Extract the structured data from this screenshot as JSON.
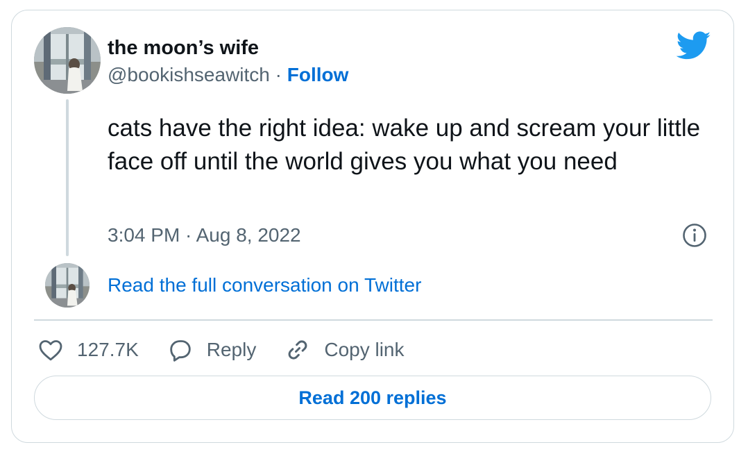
{
  "tweet": {
    "display_name": "the moon’s wife",
    "handle": "@bookishseawitch",
    "separator": " · ",
    "follow_label": "Follow",
    "text": "cats have the right idea: wake up and scream your little face off until the world gives you what you need",
    "timestamp": "3:04 PM · Aug 8, 2022",
    "read_conversation_label": "Read the full conversation on Twitter"
  },
  "actions": {
    "likes_count": "127.7K",
    "reply_label": "Reply",
    "copy_link_label": "Copy link"
  },
  "replies_button_label": "Read 200 replies",
  "icons": {
    "brand": "twitter-bird-icon",
    "info": "info-icon",
    "like": "heart-icon",
    "reply": "speech-bubble-icon",
    "copy": "link-icon"
  },
  "colors": {
    "brand_blue": "#1d9bf0",
    "link_blue": "#006fd6",
    "text": "#0f1419",
    "muted": "#536471",
    "border": "#cfd9de"
  }
}
